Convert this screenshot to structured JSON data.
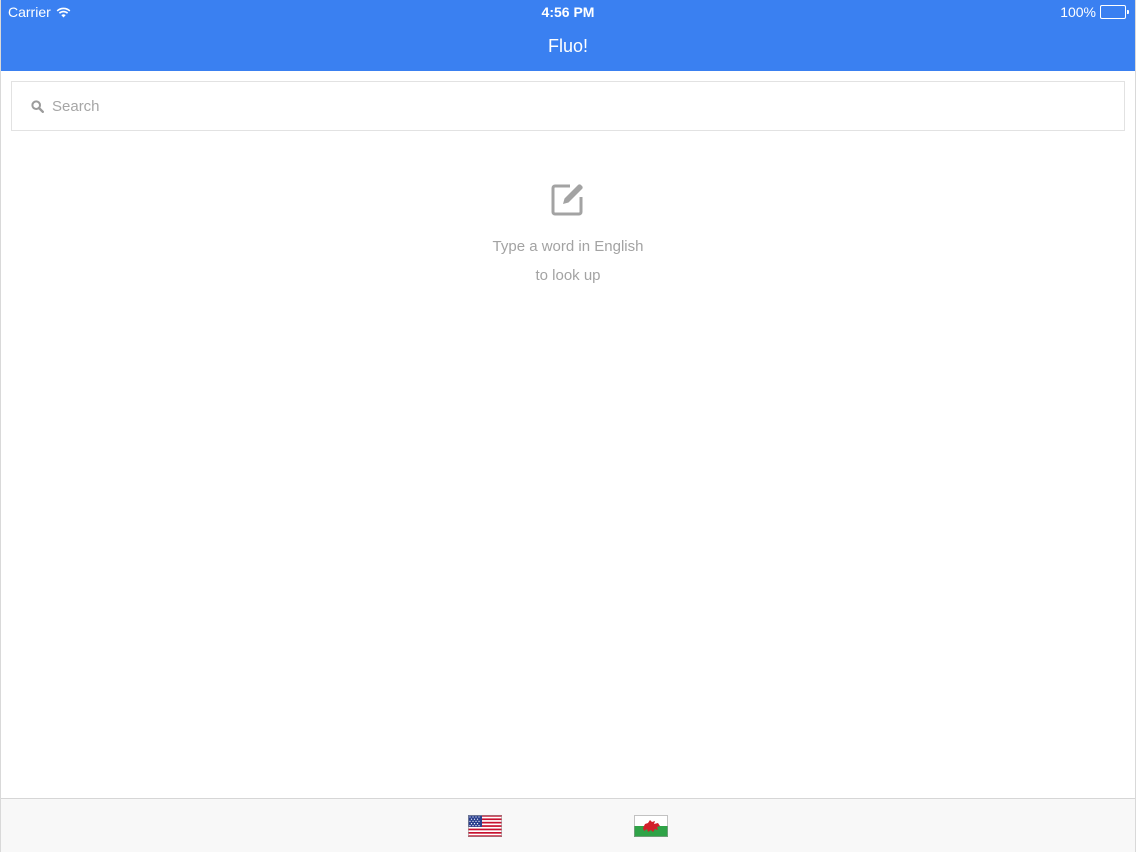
{
  "status_bar": {
    "carrier": "Carrier",
    "time": "4:56 PM",
    "battery": "100%",
    "battery_level": 1.0
  },
  "nav": {
    "title": "Fluo!"
  },
  "search": {
    "placeholder": "Search",
    "value": ""
  },
  "empty_state": {
    "icon": "edit-icon",
    "line1": "Type a word in English",
    "line2": "to look up"
  },
  "tabs": [
    {
      "icon": "us-flag-icon",
      "selected": true
    },
    {
      "icon": "wales-flag-icon",
      "selected": false
    }
  ],
  "colors": {
    "accent": "#3a80f1",
    "muted_text": "#a3a3a3"
  }
}
